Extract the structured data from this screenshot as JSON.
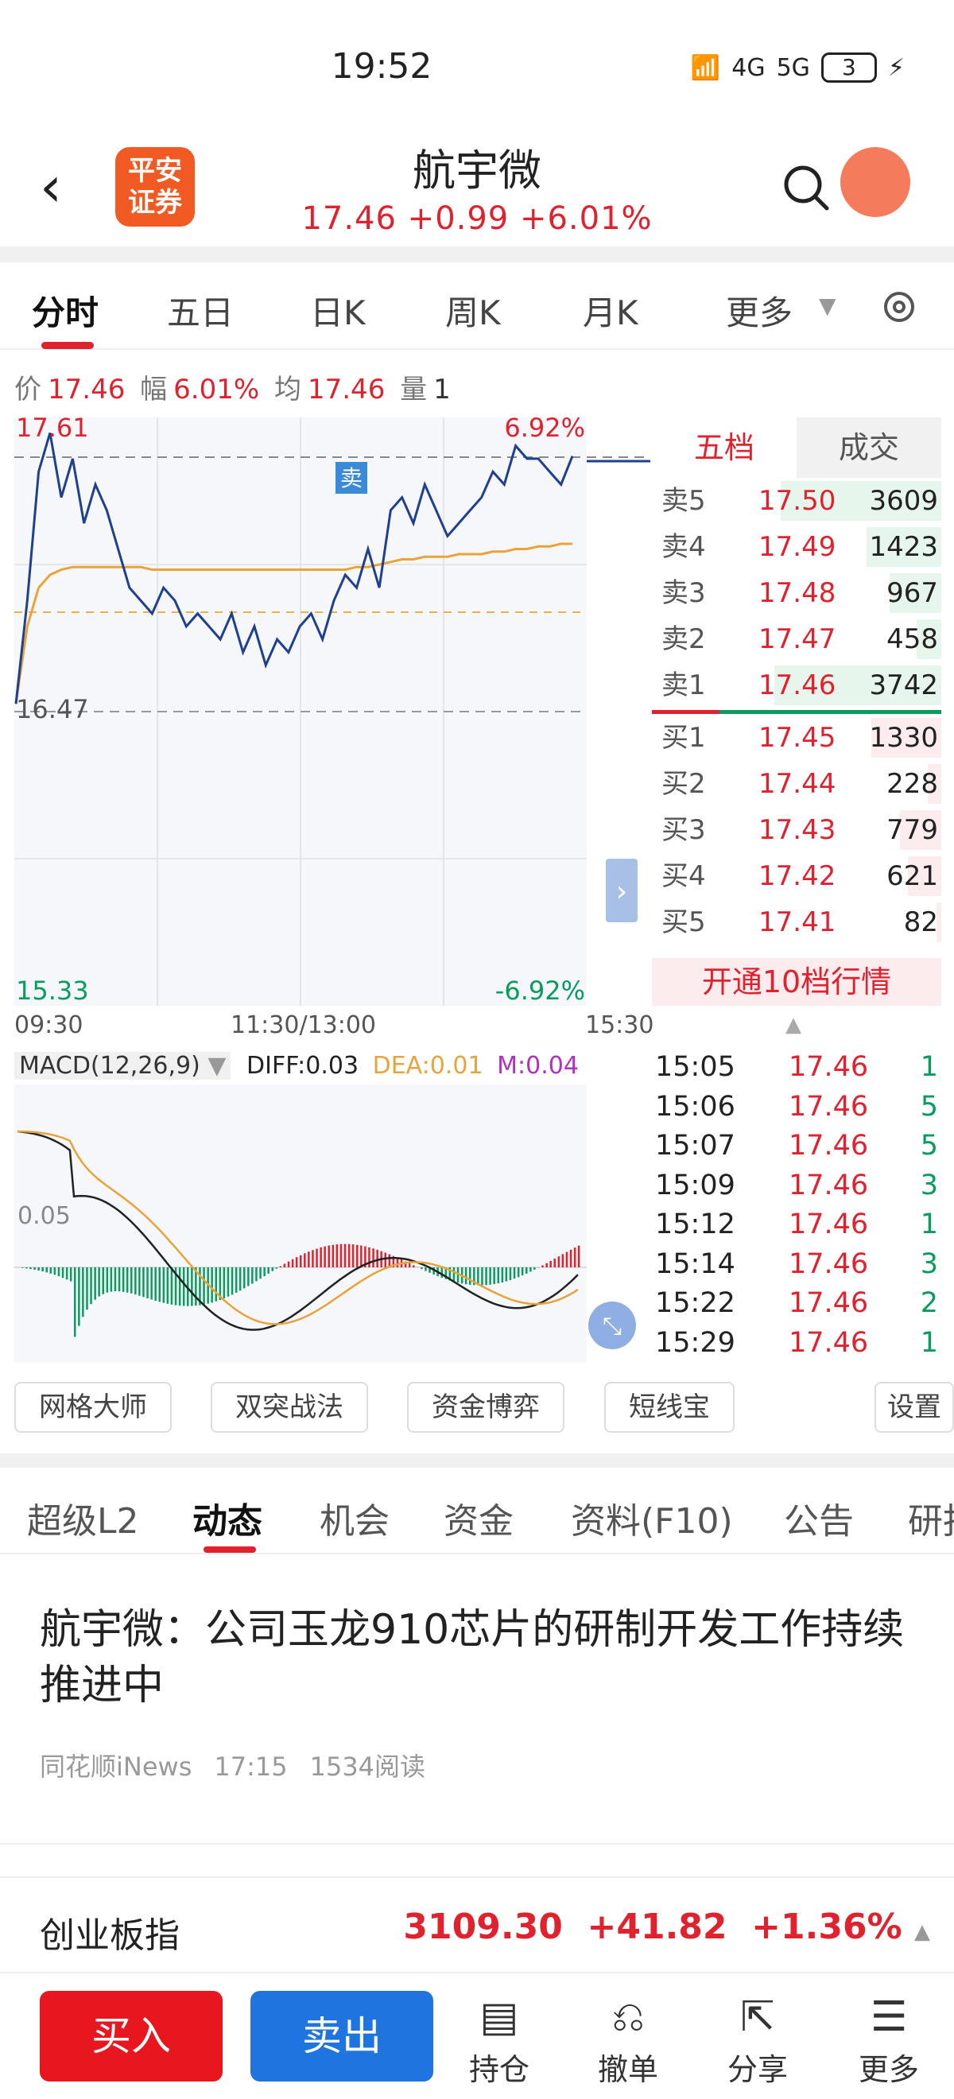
{
  "status": {
    "time": "19:52",
    "sig1": "4G",
    "sig2": "5G",
    "battery": "3"
  },
  "header": {
    "logo_line1": "平安",
    "logo_line2": "证券",
    "title": "航宇微",
    "price": "17.46",
    "change": "+0.99",
    "pct": "+6.01%"
  },
  "tabs": [
    "分时",
    "五日",
    "日K",
    "周K",
    "月K",
    "更多"
  ],
  "infobar": {
    "price_label": "价",
    "price": "17.46",
    "amp_label": "幅",
    "amp": "6.01%",
    "avg_label": "均",
    "avg": "17.46",
    "vol_label": "量",
    "vol": "1"
  },
  "chart": {
    "high": "17.61",
    "high_pct": "6.92%",
    "mid": "16.47",
    "low": "15.33",
    "low_pct": "-6.92%",
    "sell_marker": "卖",
    "time_start": "09:30",
    "time_mid": "11:30/13:00",
    "time_end": "15:30"
  },
  "chart_data": {
    "type": "line",
    "ylim": [
      15.33,
      17.61
    ],
    "series": [
      {
        "values": [
          16.5,
          16.9,
          17.4,
          17.55,
          17.3,
          17.45,
          17.2,
          17.35,
          17.25,
          17.1,
          16.95,
          16.9,
          16.85,
          16.95,
          16.9,
          16.8,
          16.85,
          16.8,
          16.75,
          16.85,
          16.7,
          16.8,
          16.65,
          16.75,
          16.7,
          16.8,
          16.85,
          16.75,
          16.9,
          17.0,
          16.95,
          17.1,
          16.95,
          17.25,
          17.3,
          17.2,
          17.35,
          17.25,
          17.15,
          17.2,
          17.25,
          17.3,
          17.4,
          17.35,
          17.5,
          17.45,
          17.45,
          17.4,
          17.35,
          17.46
        ]
      },
      {
        "values": [
          16.5,
          16.8,
          16.95,
          17.0,
          17.02,
          17.03,
          17.03,
          17.03,
          17.03,
          17.03,
          17.03,
          17.03,
          17.02,
          17.02,
          17.02,
          17.02,
          17.02,
          17.02,
          17.02,
          17.02,
          17.02,
          17.02,
          17.02,
          17.02,
          17.02,
          17.02,
          17.02,
          17.02,
          17.02,
          17.02,
          17.03,
          17.03,
          17.04,
          17.05,
          17.06,
          17.06,
          17.07,
          17.07,
          17.07,
          17.08,
          17.08,
          17.08,
          17.09,
          17.09,
          17.1,
          17.1,
          17.11,
          17.11,
          17.12,
          17.12
        ]
      }
    ]
  },
  "orderbook": {
    "tabs": [
      "五档",
      "成交"
    ],
    "sell": [
      {
        "label": "卖5",
        "price": "17.50",
        "vol": "3609",
        "w": 0.96
      },
      {
        "label": "卖4",
        "price": "17.49",
        "vol": "1423",
        "w": 0.45
      },
      {
        "label": "卖3",
        "price": "17.48",
        "vol": "967",
        "w": 0.31
      },
      {
        "label": "卖2",
        "price": "17.47",
        "vol": "458",
        "w": 0.15
      },
      {
        "label": "卖1",
        "price": "17.46",
        "vol": "3742",
        "w": 1.0
      }
    ],
    "buy": [
      {
        "label": "买1",
        "price": "17.45",
        "vol": "1330",
        "w": 0.42
      },
      {
        "label": "买2",
        "price": "17.44",
        "vol": "228",
        "w": 0.08
      },
      {
        "label": "买3",
        "price": "17.43",
        "vol": "779",
        "w": 0.25
      },
      {
        "label": "买4",
        "price": "17.42",
        "vol": "621",
        "w": 0.2
      },
      {
        "label": "买5",
        "price": "17.41",
        "vol": "82",
        "w": 0.03
      }
    ],
    "upgrade": "开通10档行情"
  },
  "trades": [
    {
      "t": "15:05",
      "p": "17.46",
      "v": "1"
    },
    {
      "t": "15:06",
      "p": "17.46",
      "v": "5"
    },
    {
      "t": "15:07",
      "p": "17.46",
      "v": "5"
    },
    {
      "t": "15:09",
      "p": "17.46",
      "v": "3"
    },
    {
      "t": "15:12",
      "p": "17.46",
      "v": "1"
    },
    {
      "t": "15:14",
      "p": "17.46",
      "v": "3"
    },
    {
      "t": "15:22",
      "p": "17.46",
      "v": "2"
    },
    {
      "t": "15:29",
      "p": "17.46",
      "v": "1"
    }
  ],
  "macd": {
    "name": "MACD(12,26,9)",
    "diff": "DIFF:0.03",
    "dea": "DEA:0.01",
    "m": "M:0.04",
    "axis": "0.05"
  },
  "tools": [
    "网格大师",
    "双突战法",
    "资金博弈",
    "短线宝",
    "设置"
  ],
  "sectabs": [
    "超级L2",
    "动态",
    "机会",
    "资金",
    "资料(F10)",
    "公告",
    "研报"
  ],
  "news": {
    "headline": "航宇微：公司玉龙910芯片的研制开发工作持续推进中",
    "source": "同花顺iNews",
    "time": "17:15",
    "reads": "1534阅读"
  },
  "index": {
    "name": "创业板指",
    "value": "3109.30",
    "change": "+41.82",
    "pct": "+1.36%"
  },
  "bottom": {
    "buy": "买入",
    "sell": "卖出",
    "hold": "持仓",
    "cancel": "撤单",
    "share": "分享",
    "more": "更多"
  },
  "colors": {
    "up": "#e0222f",
    "down": "#0a9b5e",
    "avg": "#e8a33a",
    "line": "#1f3f8f"
  }
}
